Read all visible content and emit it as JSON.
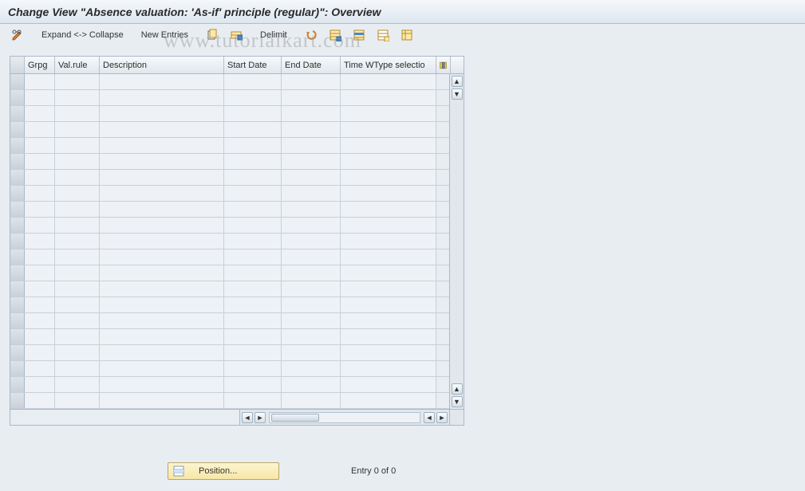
{
  "header": {
    "title": "Change View \"Absence valuation: 'As-if' principle (regular)\": Overview"
  },
  "toolbar": {
    "expand_collapse": "Expand <-> Collapse",
    "new_entries": "New Entries",
    "delimit": "Delimit"
  },
  "grid": {
    "columns": {
      "grpg": "Grpg",
      "val_rule": "Val.rule",
      "description": "Description",
      "start_date": "Start Date",
      "end_date": "End Date",
      "time_wtype": "Time WType selectio"
    },
    "row_count": 21
  },
  "footer": {
    "position_label": "Position...",
    "entry_status": "Entry 0 of 0"
  },
  "watermark": "www.tutorialkart.com"
}
